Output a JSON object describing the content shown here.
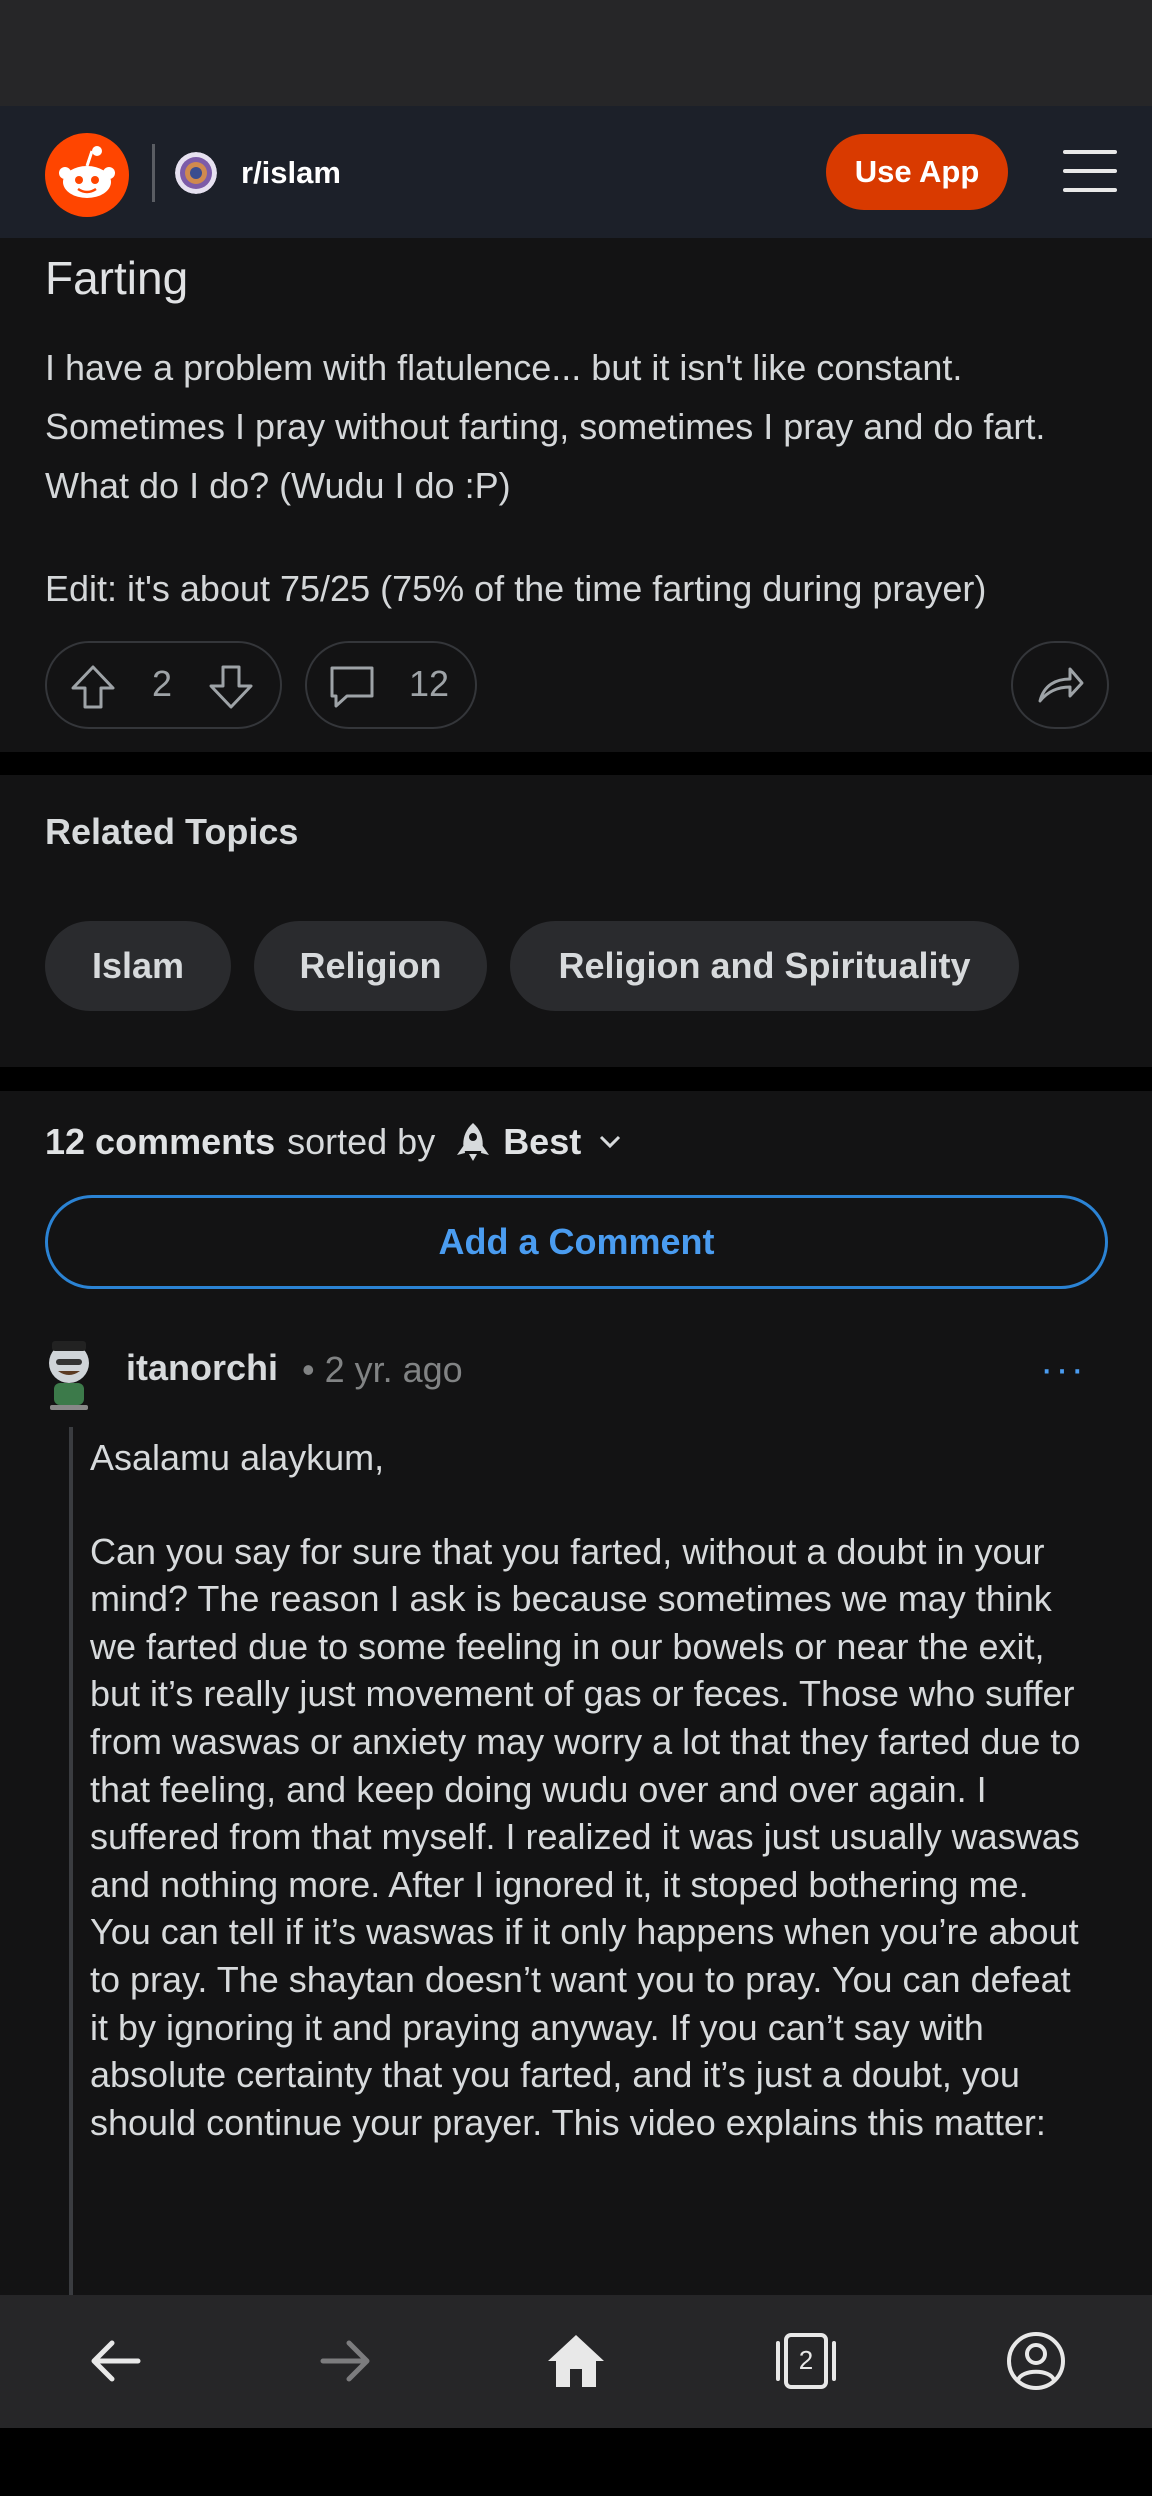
{
  "header": {
    "subreddit": "r/islam",
    "use_app_label": "Use App"
  },
  "post": {
    "title": "Farting",
    "body": [
      "I have a problem with flatulence... but it isn't like constant. Sometimes I pray without farting, sometimes I pray and do fart. What do I do? (Wudu I do :P)",
      "Edit: it's about 75/25 (75% of the time farting during prayer)"
    ],
    "vote_count": "2",
    "comment_count": "12"
  },
  "related": {
    "title": "Related Topics",
    "topics": [
      "Islam",
      "Religion",
      "Religion and Spirituality"
    ]
  },
  "comments": {
    "count_label": "12 comments",
    "sorted_by_label": "sorted by",
    "sort_value": "Best",
    "add_comment_label": "Add a Comment",
    "first": {
      "username": "itanorchi",
      "time": "• 2 yr. ago",
      "more": "···",
      "body": [
        "Asalamu alaykum,",
        "Can you say for sure that you farted, without a doubt in your mind? The reason I ask is because sometimes we may think we farted due to some feeling in our bowels or near the exit, but it’s really just movement of gas or feces. Those who suffer from waswas or anxiety may worry a lot that they farted due to that feeling, and keep doing wudu over and over again. I suffered from that myself. I realized it was just usually waswas and nothing more. After I ignored it, it stoped bothering me. You can tell if it’s waswas if it only happens when you’re about to pray. The shaytan doesn’t want you to pray. You can defeat it by ignoring it and praying anyway. If you can’t say with absolute certainty that you farted, and it’s just a doubt, you should continue your prayer. This video explains this matter:"
      ]
    }
  },
  "bottom_nav": {
    "tab_count": "2"
  },
  "colors": {
    "accent": "#d93a00",
    "link": "#4a9cf0",
    "background": "#131314",
    "header": "#1c2029"
  }
}
